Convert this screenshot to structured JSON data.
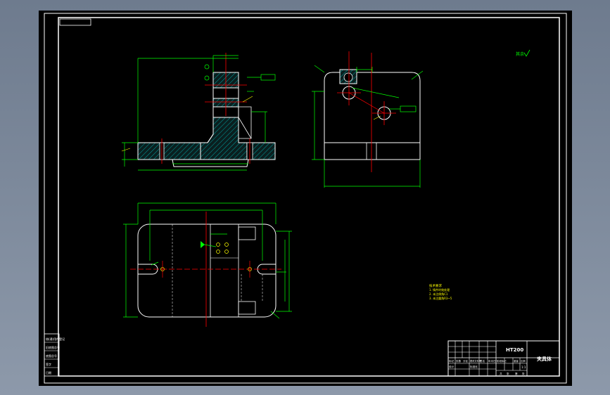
{
  "drawing": {
    "title_block": {
      "part_code": "HT200",
      "part_name": "夹具体",
      "header_cells": [
        "标记",
        "处数",
        "分区",
        "更改文件号",
        "签名",
        "年月日"
      ],
      "role_cells": [
        "设计",
        "标准化"
      ],
      "stage_cells": [
        "阶段标记",
        "重量",
        "比例"
      ],
      "scale": "1:1",
      "sheet_cells": [
        "共",
        "张",
        "第",
        "张"
      ]
    },
    "side_labels": [
      "借(通)用件登记",
      "旧底图总号",
      "底图总号",
      "签字",
      "日期"
    ],
    "roughness_note": "其余",
    "tech_requirements": {
      "title": "技术要求",
      "items": [
        "1. 铸件时效处理",
        "2. 未注倒角C1",
        "3. 未注圆角R3~5"
      ]
    }
  },
  "colors": {
    "background": "#000000",
    "outline": "#ffffff",
    "dimension": "#00ff00",
    "centerline": "#ff0000",
    "hatch": "#00a0a0",
    "annotation": "#ffff00"
  }
}
